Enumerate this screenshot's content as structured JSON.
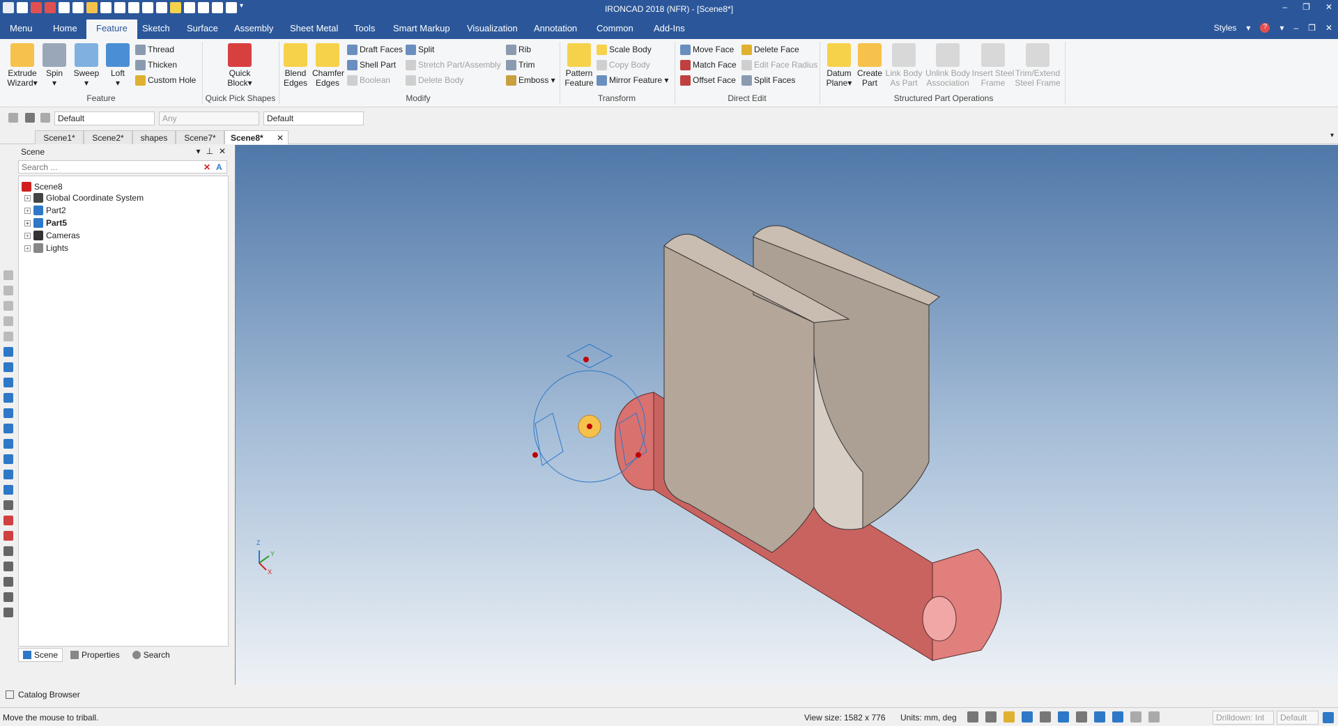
{
  "titlebar": {
    "title": "IRONCAD 2018 (NFR) - [Scene8*]",
    "controls": [
      "–",
      "❐",
      "✕"
    ]
  },
  "menubar": {
    "tabs": [
      "Menu",
      "Home",
      "Feature",
      "Sketch",
      "Surface",
      "Assembly",
      "Sheet Metal",
      "Tools",
      "Smart Markup",
      "Visualization",
      "Annotation",
      "Common",
      "Add-Ins"
    ],
    "active_tab": "Feature",
    "right": {
      "styles": "Styles",
      "controls": [
        "▾",
        "?",
        "▾",
        "–",
        "❐",
        "✕"
      ]
    }
  },
  "ribbon": {
    "groups": {
      "feature": {
        "label": "Feature",
        "extrude": "Extrude\nWizard▾",
        "spin": "Spin\n▾",
        "sweep": "Sweep\n▾",
        "loft": "Loft\n▾",
        "thread": "Thread",
        "thicken": "Thicken",
        "custom_hole": "Custom Hole"
      },
      "quick_pick": {
        "label": "Quick Pick Shapes",
        "quick_block": "Quick\nBlock▾"
      },
      "modify": {
        "label": "Modify",
        "blend": "Blend\nEdges",
        "chamfer": "Chamfer\nEdges",
        "draft_faces": "Draft Faces",
        "shell_part": "Shell Part",
        "boolean": "Boolean",
        "split": "Split",
        "stretch": "Stretch Part/Assembly",
        "delete_body": "Delete Body",
        "rib": "Rib",
        "trim": "Trim",
        "emboss": "Emboss ▾"
      },
      "transform": {
        "label": "Transform",
        "pattern": "Pattern\nFeature",
        "scale_body": "Scale Body",
        "copy_body": "Copy Body",
        "mirror": "Mirror Feature ▾"
      },
      "direct_edit": {
        "label": "Direct Edit",
        "move_face": "Move Face",
        "match_face": "Match Face",
        "offset_face": "Offset Face",
        "delete_face": "Delete Face",
        "edit_face_radius": "Edit Face Radius",
        "split_faces": "Split Faces"
      },
      "structured": {
        "label": "Structured Part Operations",
        "datum_plane": "Datum\nPlane▾",
        "create_part": "Create\nPart",
        "link_body": "Link Body\nAs Part",
        "unlink_body": "Unlink Body\nAssociation",
        "insert_steel": "Insert Steel\nFrame",
        "trim_extend": "Trim/Extend\nSteel Frame"
      }
    }
  },
  "toolbar2": {
    "combo1": "Default",
    "combo2": "Any",
    "combo3": "Default"
  },
  "doc_tabs": [
    "Scene1*",
    "Scene2*",
    "shapes",
    "Scene7*",
    "Scene8*"
  ],
  "active_doc_tab": "Scene8*",
  "panel": {
    "title": "Scene",
    "search_placeholder": "Search ...",
    "tree": {
      "root": "Scene8",
      "items": [
        "Global Coordinate System",
        "Part2",
        "Part5",
        "Cameras",
        "Lights"
      ]
    },
    "tabs": [
      "Scene",
      "Properties",
      "Search"
    ]
  },
  "catalog": "Catalog Browser",
  "status": {
    "message": "Move the mouse to triball.",
    "view_size": "View size: 1582 x  776",
    "units": "Units: mm, deg",
    "drilldown": "Drilldown: Int",
    "default": "Default"
  },
  "axis_labels": {
    "z": "Z",
    "y": "Y",
    "x": "X"
  },
  "colors": {
    "title_blue": "#2b579a",
    "part_red": "#d9716f",
    "part_gray": "#b8aba0"
  }
}
